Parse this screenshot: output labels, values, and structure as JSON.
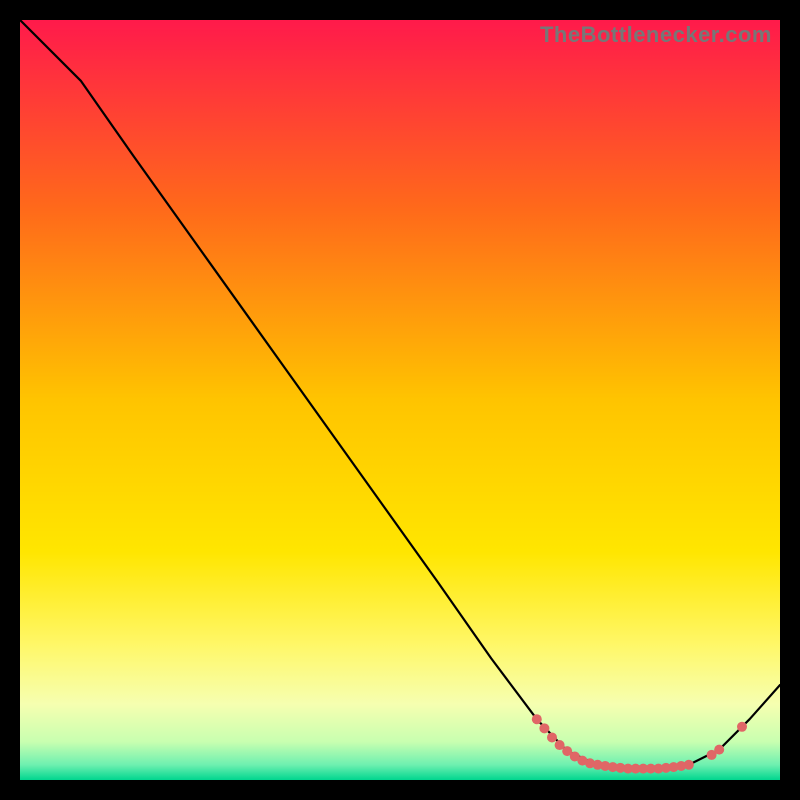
{
  "watermark": "TheBottlenecker.com",
  "chart_data": {
    "type": "line",
    "title": "",
    "xlabel": "",
    "ylabel": "",
    "xlim": [
      0,
      100
    ],
    "ylim": [
      0,
      100
    ],
    "grid": false,
    "legend": false,
    "background_gradient": {
      "top": "#ff1a4b",
      "mid_upper": "#ff7a1a",
      "mid": "#ffd400",
      "mid_lower": "#ffff66",
      "band_top": "#f8ffa0",
      "band_bottom": "#00d68f"
    },
    "series": [
      {
        "name": "curve",
        "color": "#000000",
        "points": [
          {
            "x": 0,
            "y": 100
          },
          {
            "x": 8,
            "y": 92
          },
          {
            "x": 15,
            "y": 82
          },
          {
            "x": 25,
            "y": 68
          },
          {
            "x": 35,
            "y": 54
          },
          {
            "x": 45,
            "y": 40
          },
          {
            "x": 55,
            "y": 26
          },
          {
            "x": 62,
            "y": 16
          },
          {
            "x": 68,
            "y": 8
          },
          {
            "x": 72,
            "y": 3.8
          },
          {
            "x": 76,
            "y": 2.0
          },
          {
            "x": 80,
            "y": 1.5
          },
          {
            "x": 84,
            "y": 1.5
          },
          {
            "x": 88,
            "y": 2.0
          },
          {
            "x": 92,
            "y": 4.0
          },
          {
            "x": 96,
            "y": 8.0
          },
          {
            "x": 100,
            "y": 12.5
          }
        ]
      },
      {
        "name": "markers",
        "type": "scatter",
        "color": "#e06666",
        "points": [
          {
            "x": 68,
            "y": 8.0
          },
          {
            "x": 69,
            "y": 6.8
          },
          {
            "x": 70,
            "y": 5.6
          },
          {
            "x": 71,
            "y": 4.6
          },
          {
            "x": 72,
            "y": 3.8
          },
          {
            "x": 73,
            "y": 3.1
          },
          {
            "x": 74,
            "y": 2.55
          },
          {
            "x": 75,
            "y": 2.2
          },
          {
            "x": 76,
            "y": 2.0
          },
          {
            "x": 77,
            "y": 1.85
          },
          {
            "x": 78,
            "y": 1.7
          },
          {
            "x": 79,
            "y": 1.6
          },
          {
            "x": 80,
            "y": 1.5
          },
          {
            "x": 81,
            "y": 1.5
          },
          {
            "x": 82,
            "y": 1.5
          },
          {
            "x": 83,
            "y": 1.5
          },
          {
            "x": 84,
            "y": 1.5
          },
          {
            "x": 85,
            "y": 1.6
          },
          {
            "x": 86,
            "y": 1.7
          },
          {
            "x": 87,
            "y": 1.85
          },
          {
            "x": 88,
            "y": 2.0
          },
          {
            "x": 91,
            "y": 3.3
          },
          {
            "x": 92,
            "y": 4.0
          },
          {
            "x": 95,
            "y": 7.0
          }
        ]
      }
    ]
  }
}
